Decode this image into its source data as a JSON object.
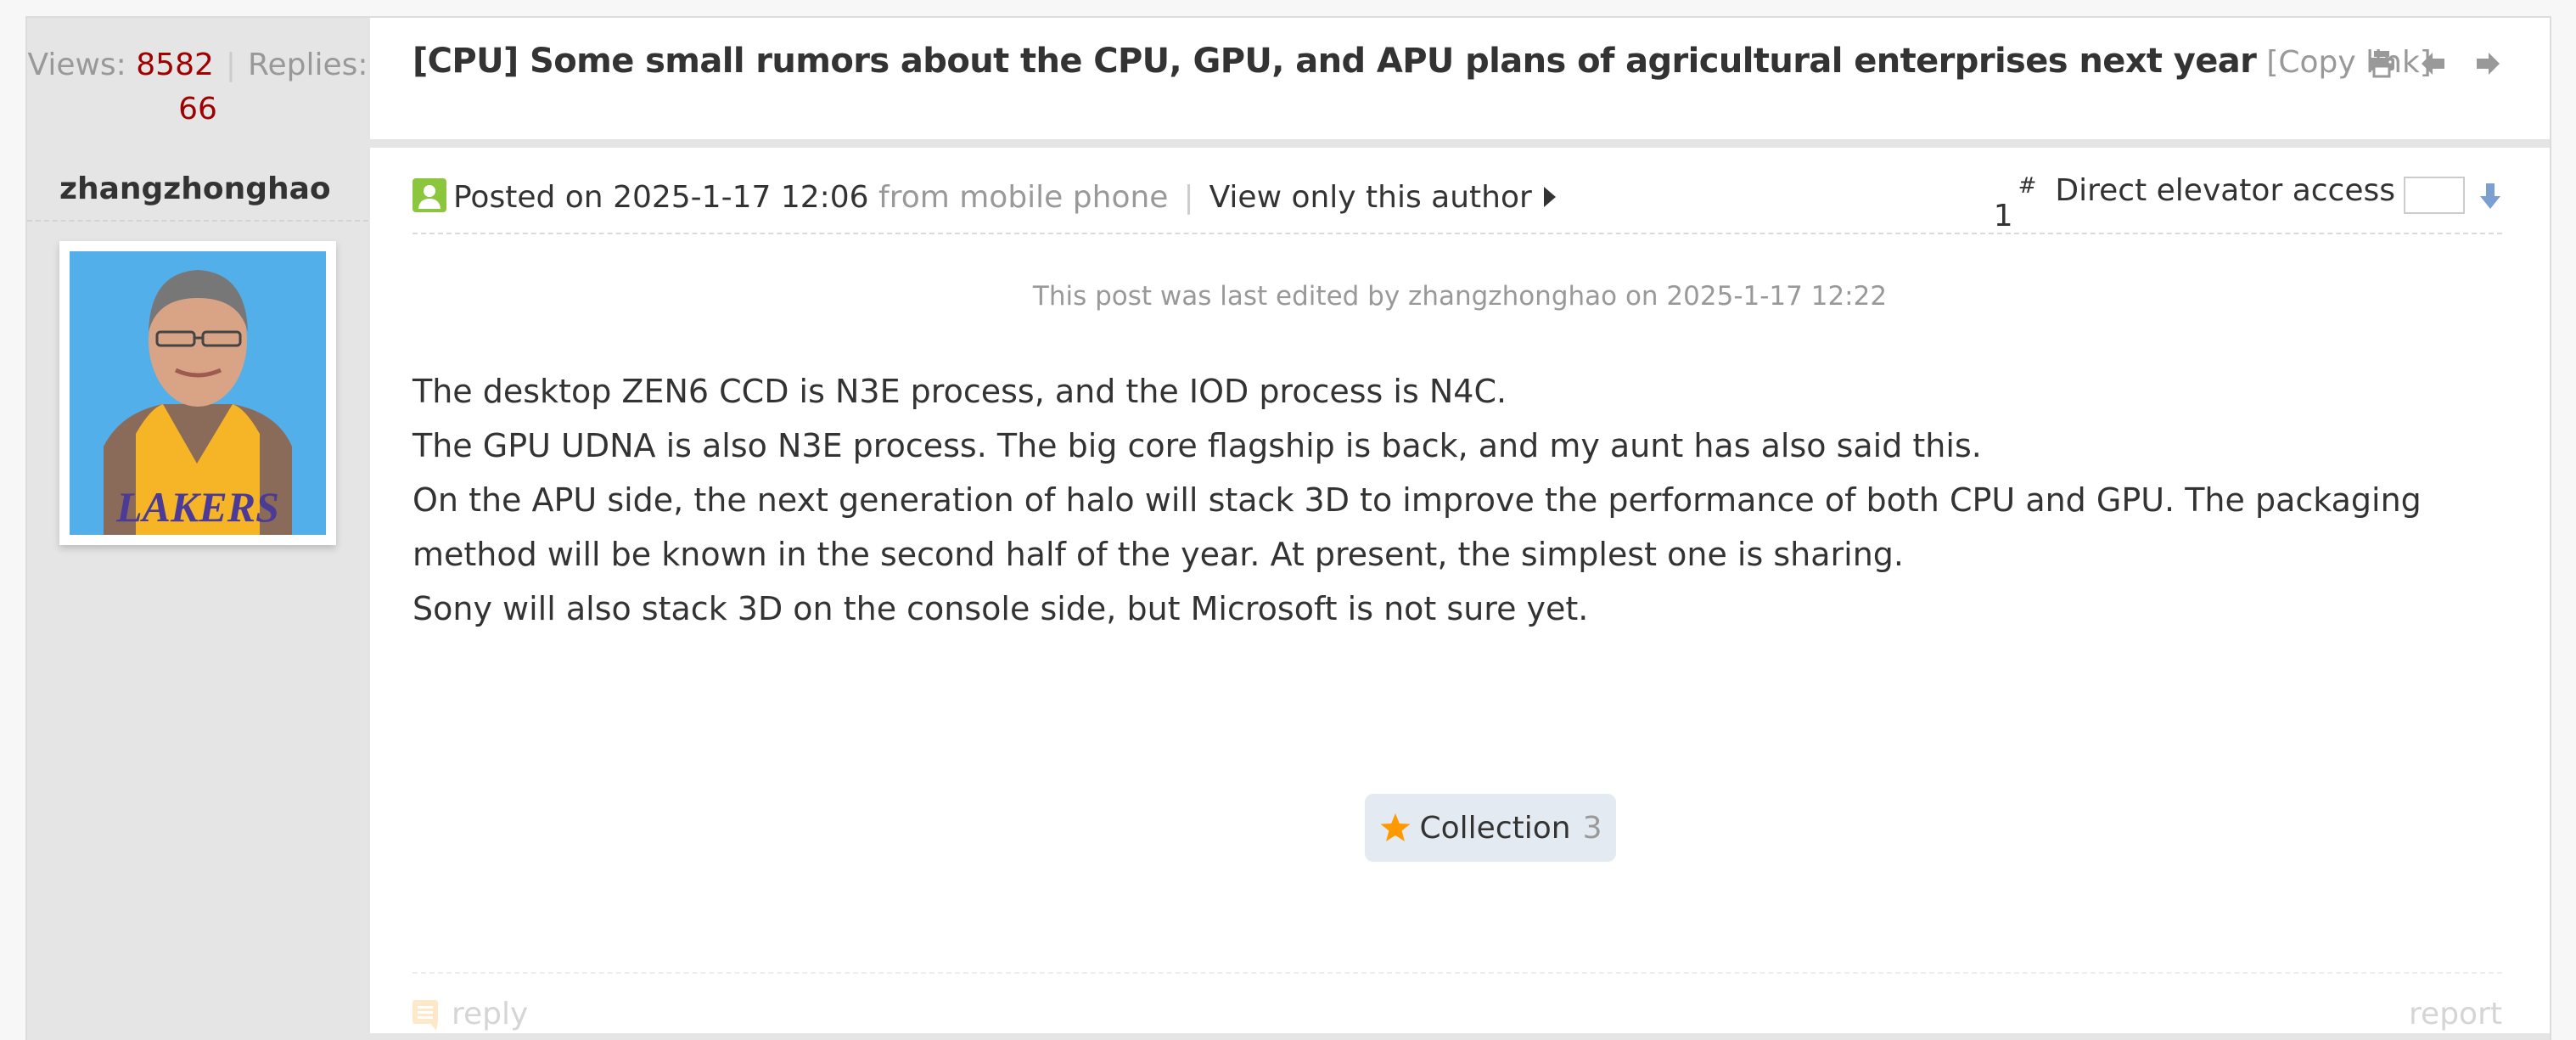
{
  "thread_stats": {
    "views_label": "Views:",
    "views": "8582",
    "separator": "|",
    "replies_label": "Replies:",
    "replies": "66"
  },
  "thread": {
    "title": "[CPU] Some small rumors about the CPU, GPU, and APU plans of agricultural enterprises next year",
    "copy_link": "[Copy link]",
    "icons": [
      "print-icon",
      "previous-thread-icon",
      "next-thread-icon"
    ]
  },
  "post": {
    "author": "zhangzhonghao",
    "avatar_alt": "avatar photo (person in yellow LAKERS jersey)",
    "avatar_jersey_text": "LAKERS",
    "posted_prefix": "Posted on",
    "posted_time": "2025-1-17 12:06",
    "source": "from mobile phone",
    "separator": "|",
    "view_only_author": "View only this author",
    "floor_number": "1",
    "floor_hash": "#",
    "jump_label": "Direct elevator access",
    "jump_value": "",
    "edited_notice": "This post was last edited by zhangzhonghao on 2025-1-17 12:22",
    "body": [
      "The desktop ZEN6 CCD is N3E process, and the IOD process is N4C.",
      "The GPU UDNA is also N3E process. The big core flagship is back, and my aunt has also said this.",
      "On the APU side, the next generation of halo will stack 3D to improve the performance of both CPU and GPU. The packaging method will be known in the second half of the year. At present, the simplest one is sharing.",
      "Sony will also stack 3D on the console side, but Microsoft is not sure yet."
    ],
    "collection_label": "Collection",
    "collection_count": "3",
    "reply_label": "reply",
    "report_label": "report"
  },
  "colors": {
    "count_red": "#a00000",
    "star_orange": "#ff9900",
    "user_icon_green": "#8cc63f",
    "jump_arrow_blue": "#7b9fd1",
    "collection_bg": "#e4eaf1",
    "sidebar_gray": "#e5e5e5"
  }
}
